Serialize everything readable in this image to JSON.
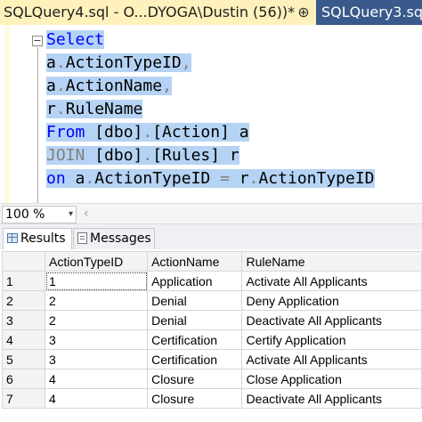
{
  "tabs": {
    "active_title": "SQLQuery4.sql - O...DYOGA\\Dustin (56))*",
    "pin_glyph": "⊕",
    "close_glyph": "×",
    "inactive_title": "SQLQuery3.sq"
  },
  "query": {
    "lines": [
      {
        "parts": [
          {
            "t": "Select",
            "c": "kw"
          }
        ]
      },
      {
        "parts": [
          {
            "t": "a",
            "c": "txt"
          },
          {
            "t": ".",
            "c": "gray"
          },
          {
            "t": "ActionTypeID",
            "c": "txt"
          },
          {
            "t": ",",
            "c": "gray"
          }
        ]
      },
      {
        "parts": [
          {
            "t": "a",
            "c": "txt"
          },
          {
            "t": ".",
            "c": "gray"
          },
          {
            "t": "ActionName",
            "c": "txt"
          },
          {
            "t": ",",
            "c": "gray"
          }
        ]
      },
      {
        "parts": [
          {
            "t": "r",
            "c": "txt"
          },
          {
            "t": ".",
            "c": "gray"
          },
          {
            "t": "RuleName",
            "c": "txt"
          }
        ]
      },
      {
        "parts": [
          {
            "t": "From ",
            "c": "kw"
          },
          {
            "t": "[dbo]",
            "c": "txt"
          },
          {
            "t": ".",
            "c": "gray"
          },
          {
            "t": "[Action] a",
            "c": "txt"
          }
        ]
      },
      {
        "parts": [
          {
            "t": "JOIN ",
            "c": "gray"
          },
          {
            "t": "[dbo]",
            "c": "txt"
          },
          {
            "t": ".",
            "c": "gray"
          },
          {
            "t": "[Rules] r",
            "c": "txt"
          }
        ]
      },
      {
        "parts": [
          {
            "t": "on ",
            "c": "kw"
          },
          {
            "t": "a",
            "c": "txt"
          },
          {
            "t": ".",
            "c": "gray"
          },
          {
            "t": "ActionTypeID ",
            "c": "txt"
          },
          {
            "t": "=",
            "c": "gray"
          },
          {
            "t": " r",
            "c": "txt"
          },
          {
            "t": ".",
            "c": "gray"
          },
          {
            "t": "ActionTypeID",
            "c": "txt"
          }
        ]
      }
    ]
  },
  "zoom": {
    "value": "100 %",
    "arrow": "▾",
    "scroll_glyph": "‹"
  },
  "results_tabs": {
    "results": "Results",
    "messages": "Messages"
  },
  "grid": {
    "columns": [
      "ActionTypeID",
      "ActionName",
      "RuleName"
    ],
    "rows": [
      {
        "n": "1",
        "cells": [
          "1",
          "Application",
          "Activate All Applicants"
        ]
      },
      {
        "n": "2",
        "cells": [
          "2",
          "Denial",
          "Deny Application"
        ]
      },
      {
        "n": "3",
        "cells": [
          "2",
          "Denial",
          "Deactivate All Applicants"
        ]
      },
      {
        "n": "4",
        "cells": [
          "3",
          "Certification",
          "Certify Application"
        ]
      },
      {
        "n": "5",
        "cells": [
          "3",
          "Certification",
          "Activate All Applicants"
        ]
      },
      {
        "n": "6",
        "cells": [
          "4",
          "Closure",
          "Close Application"
        ]
      },
      {
        "n": "7",
        "cells": [
          "4",
          "Closure",
          "Deactivate All Applicants"
        ]
      }
    ]
  },
  "colors": {
    "active_tab": "#fff1bc",
    "inactive_tab": "#3a5a8c",
    "keyword": "#0000ff",
    "selection": "#b5d3f4"
  }
}
